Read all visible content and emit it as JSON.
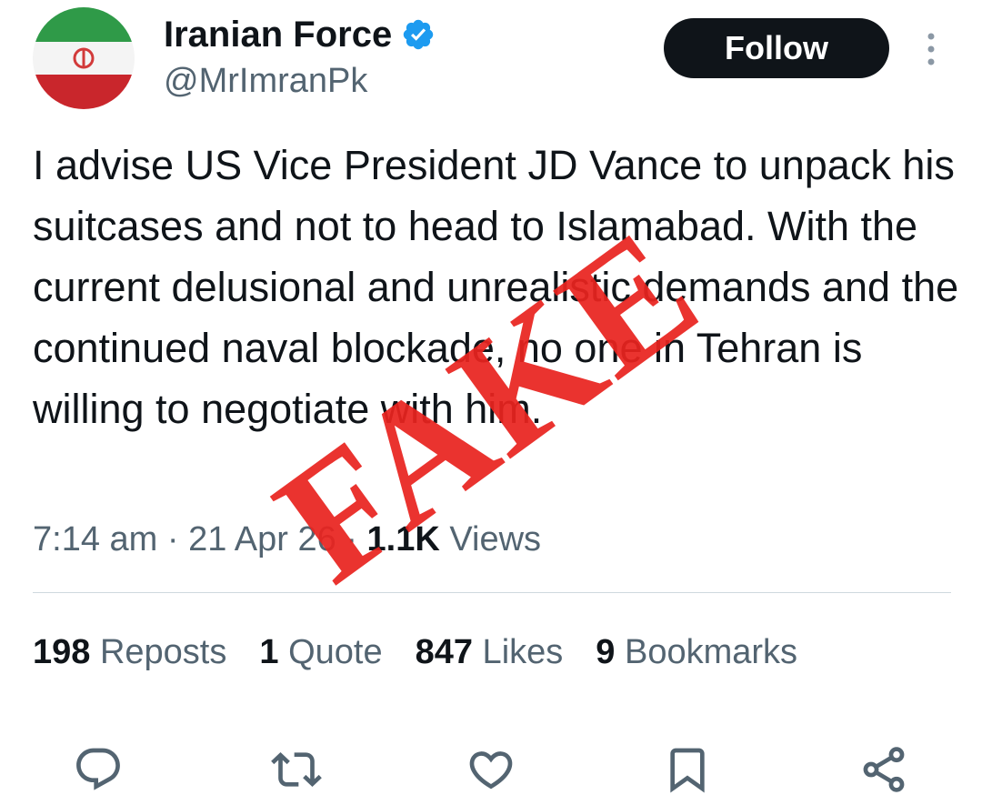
{
  "user": {
    "display_name": "Iranian Force",
    "handle": "@MrImranPk",
    "verified": true,
    "avatar_icon": "iran-flag-avatar"
  },
  "header": {
    "follow_label": "Follow",
    "more_icon": "more-vertical-icon"
  },
  "tweet": {
    "text": "I advise US Vice President JD Vance to unpack his suitcases and not to head to Islamabad. With the current delusional and unrealistic demands and the continued naval blockade, no one in Tehran is willing to negotiate with him.",
    "meta_prefix": "7:14 am · 21 Apr 26 · ",
    "views_count": "1.1K",
    "views_label": " Views"
  },
  "stats": {
    "reposts_count": "198",
    "reposts_label": " Reposts",
    "quotes_count": "1",
    "quotes_label": " Quote",
    "likes_count": "847",
    "likes_label": " Likes",
    "bookmarks_count": "9",
    "bookmarks_label": " Bookmarks"
  },
  "actions": [
    {
      "icon": "reply-icon"
    },
    {
      "icon": "repost-icon"
    },
    {
      "icon": "like-icon"
    },
    {
      "icon": "bookmark-icon"
    },
    {
      "icon": "share-icon"
    }
  ],
  "overlay": {
    "stamp_text": "FAKE",
    "stamp_color": "#e8231f"
  },
  "colors": {
    "text_primary": "#0f1419",
    "text_secondary": "#536471",
    "verified_blue": "#1d9bf0",
    "divider": "#cfd9de"
  }
}
